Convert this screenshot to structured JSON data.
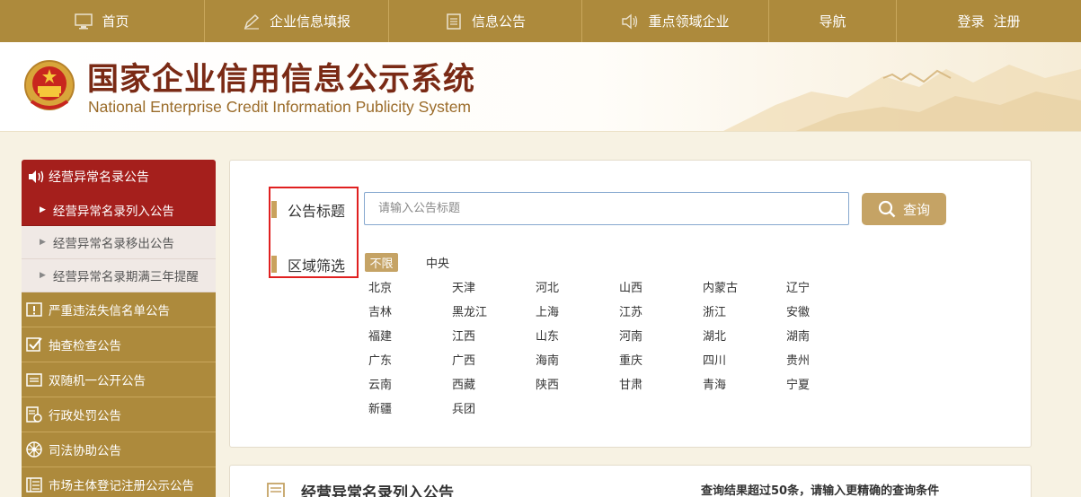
{
  "topnav": {
    "home": "首页",
    "fill_report": "企业信息填报",
    "info_notice": "信息公告",
    "key_enterprise": "重点领域企业",
    "guide": "导航",
    "login": "登录",
    "register": "注册"
  },
  "header": {
    "title": "国家企业信用信息公示系统",
    "subtitle": "National Enterprise Credit Information Publicity System"
  },
  "sidebar": {
    "head": "经营异常名录公告",
    "sub_items": [
      {
        "label": "经营异常名录列入公告",
        "active": true
      },
      {
        "label": "经营异常名录移出公告",
        "active": false
      },
      {
        "label": "经营异常名录期满三年提醒",
        "active": false
      }
    ],
    "categories": [
      {
        "label": "严重违法失信名单公告",
        "icon": "warning-board-icon"
      },
      {
        "label": "抽查检查公告",
        "icon": "checkbox-icon"
      },
      {
        "label": "双随机一公开公告",
        "icon": "tray-icon"
      },
      {
        "label": "行政处罚公告",
        "icon": "document-seal-icon"
      },
      {
        "label": "司法协助公告",
        "icon": "wheel-icon"
      },
      {
        "label": "市场主体登记注册公示公告",
        "icon": "building-icon"
      }
    ]
  },
  "search": {
    "title_label": "公告标题",
    "placeholder": "请输入公告标题",
    "button": "查询",
    "region_label": "区域筛选",
    "filter_all": "不限",
    "filter_central": "中央",
    "provinces": [
      "北京",
      "天津",
      "河北",
      "山西",
      "内蒙古",
      "辽宁",
      "吉林",
      "黑龙江",
      "上海",
      "江苏",
      "浙江",
      "安徽",
      "福建",
      "江西",
      "山东",
      "河南",
      "湖北",
      "湖南",
      "广东",
      "广西",
      "海南",
      "重庆",
      "四川",
      "贵州",
      "云南",
      "西藏",
      "陕西",
      "甘肃",
      "青海",
      "宁夏",
      "新疆",
      "兵团"
    ]
  },
  "result": {
    "title": "经营异常名录列入公告",
    "note": "查询结果超过50条，请输入更精确的查询条件"
  },
  "colors": {
    "nav_gold": "#ad8a3c",
    "sidebar_red": "#a51f1c",
    "button_gold": "#c5a365",
    "title_brown": "#7a2a15",
    "highlight_red": "#e02020"
  }
}
